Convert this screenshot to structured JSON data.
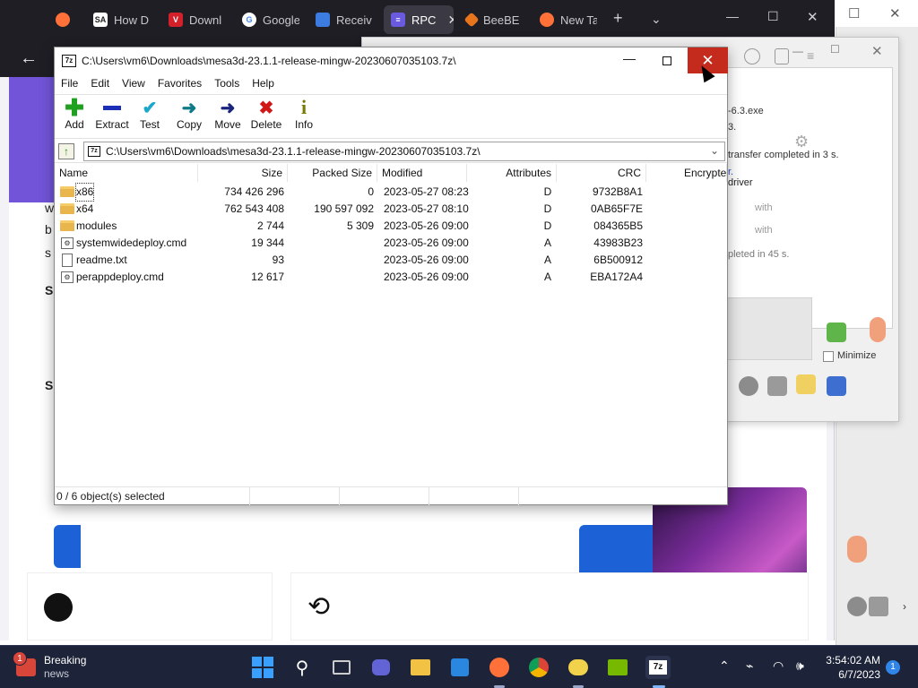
{
  "browser": {
    "tabs": [
      {
        "label": "",
        "icon": "firefox-icon"
      },
      {
        "label": "How D",
        "icon": "sa-icon"
      },
      {
        "label": "Downl",
        "icon": "v-icon"
      },
      {
        "label": "Google",
        "icon": "google-icon"
      },
      {
        "label": "Receiv",
        "icon": "chat-icon"
      },
      {
        "label": "RPC",
        "icon": "rpc-icon"
      },
      {
        "label": "BeeBE",
        "icon": "beebeep-icon"
      },
      {
        "label": "New Ta",
        "icon": "firefox-icon"
      }
    ],
    "side_text": [
      "w",
      "b",
      "s",
      "S",
      "S"
    ]
  },
  "bg_window": {
    "lines": [
      "-6.3.exe",
      "3.",
      "transfer completed in 3 s.",
      "r.",
      "driver",
      "with",
      "with",
      "pleted in 45 s."
    ],
    "minimize_label": "Minimize"
  },
  "zip": {
    "title": "C:\\Users\\vm6\\Downloads\\mesa3d-23.1.1-release-mingw-20230607035103.7z\\",
    "menu": [
      "File",
      "Edit",
      "View",
      "Favorites",
      "Tools",
      "Help"
    ],
    "toolbar": [
      {
        "label": "Add",
        "icon": "plus-icon",
        "glyph": "+",
        "color": "#1fa01f"
      },
      {
        "label": "Extract",
        "icon": "minus-icon",
        "glyph": "—",
        "color": "#1a2fb5"
      },
      {
        "label": "Test",
        "icon": "check-icon",
        "glyph": "✓",
        "color": "#1aa7c9"
      },
      {
        "label": "Copy",
        "icon": "copy-arrow-icon",
        "glyph": "➜",
        "color": "#0f7a87"
      },
      {
        "label": "Move",
        "icon": "move-arrow-icon",
        "glyph": "➜",
        "color": "#1a237e"
      },
      {
        "label": "Delete",
        "icon": "delete-x-icon",
        "glyph": "✕",
        "color": "#d01818"
      },
      {
        "label": "Info",
        "icon": "info-icon",
        "glyph": "i",
        "color": "#6a6a00"
      }
    ],
    "address": "C:\\Users\\vm6\\Downloads\\mesa3d-23.1.1-release-mingw-20230607035103.7z\\",
    "columns": [
      "Name",
      "Size",
      "Packed Size",
      "Modified",
      "Attributes",
      "CRC",
      "Encrypte"
    ],
    "rows": [
      {
        "name": "x86",
        "size": "734 426 296",
        "packed": "0",
        "modified": "2023-05-27 08:23",
        "attr": "D",
        "crc": "9732B8A1",
        "type": "folder"
      },
      {
        "name": "x64",
        "size": "762 543 408",
        "packed": "190 597 092",
        "modified": "2023-05-27 08:10",
        "attr": "D",
        "crc": "0AB65F7E",
        "type": "folder"
      },
      {
        "name": "modules",
        "size": "2 744",
        "packed": "5 309",
        "modified": "2023-05-26 09:00",
        "attr": "D",
        "crc": "084365B5",
        "type": "folder"
      },
      {
        "name": "systemwidedeploy.cmd",
        "size": "19 344",
        "packed": "",
        "modified": "2023-05-26 09:00",
        "attr": "A",
        "crc": "43983B23",
        "type": "cmd"
      },
      {
        "name": "readme.txt",
        "size": "93",
        "packed": "",
        "modified": "2023-05-26 09:00",
        "attr": "A",
        "crc": "6B500912",
        "type": "txt"
      },
      {
        "name": "perappdeploy.cmd",
        "size": "12 617",
        "packed": "",
        "modified": "2023-05-26 09:00",
        "attr": "A",
        "crc": "EBA172A4",
        "type": "cmd"
      }
    ],
    "status": "0 / 6 object(s) selected"
  },
  "taskbar": {
    "weather_badge": "1",
    "weather_line1": "Breaking",
    "weather_line2": "news",
    "time": "3:54:02 AM",
    "date": "6/7/2023",
    "notifications": "1"
  }
}
